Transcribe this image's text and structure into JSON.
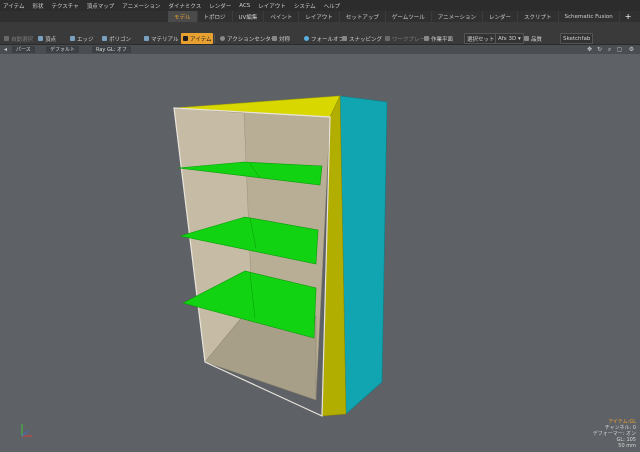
{
  "menu": [
    "アイテム",
    "形状",
    "テクスチャ",
    "頂点マップ",
    "アニメーション",
    "ダイナミクス",
    "レンダー",
    "ACS",
    "レイアウト",
    "システム",
    "ヘルプ"
  ],
  "tabs": [
    {
      "label": "モデル",
      "active": true
    },
    {
      "label": "トポロジ",
      "active": false
    },
    {
      "label": "UV編集",
      "active": false
    },
    {
      "label": "ペイント",
      "active": false
    },
    {
      "label": "レイアウト",
      "active": false
    },
    {
      "label": "セットアップ",
      "active": false
    },
    {
      "label": "ゲームツール",
      "active": false
    },
    {
      "label": "アニメーション",
      "active": false
    },
    {
      "label": "レンダー",
      "active": false
    },
    {
      "label": "スクリプト",
      "active": false
    },
    {
      "label": "Schematic Fusion",
      "active": false
    },
    {
      "label": "+",
      "active": false
    }
  ],
  "toolbar": {
    "autoselect": "自動選択",
    "vertices": "頂点",
    "edges": "エッジ",
    "polygons": "ポリゴン",
    "material": "マテリアル",
    "items": "アイテム",
    "action_center": "アクションセンター",
    "symmetry": "対称",
    "falloff": "フォールオフ",
    "snapping": "スナッピング",
    "workplane_mode": "ワークプレーン",
    "workplane": "作業平面",
    "select_set": "選択セット",
    "afx": "Afx 3D",
    "display": "品質",
    "sketchfab": "Sketchfab"
  },
  "viewport_header": {
    "view": "パース",
    "style": "デフォルト",
    "ray_gl": "Ray GL: オフ"
  },
  "info": {
    "item": "アイテム:GL",
    "channels": "チャンネル: 0",
    "deformers": "デフォーマー: オン",
    "gl": "GL: 105",
    "lens": "50 mm"
  },
  "colors": {
    "accent": "#e8a030",
    "shelf_green": "#11d311",
    "side_cyan": "#10a5b0",
    "top_yellow": "#d8d800",
    "interior": "#b8ad95"
  }
}
